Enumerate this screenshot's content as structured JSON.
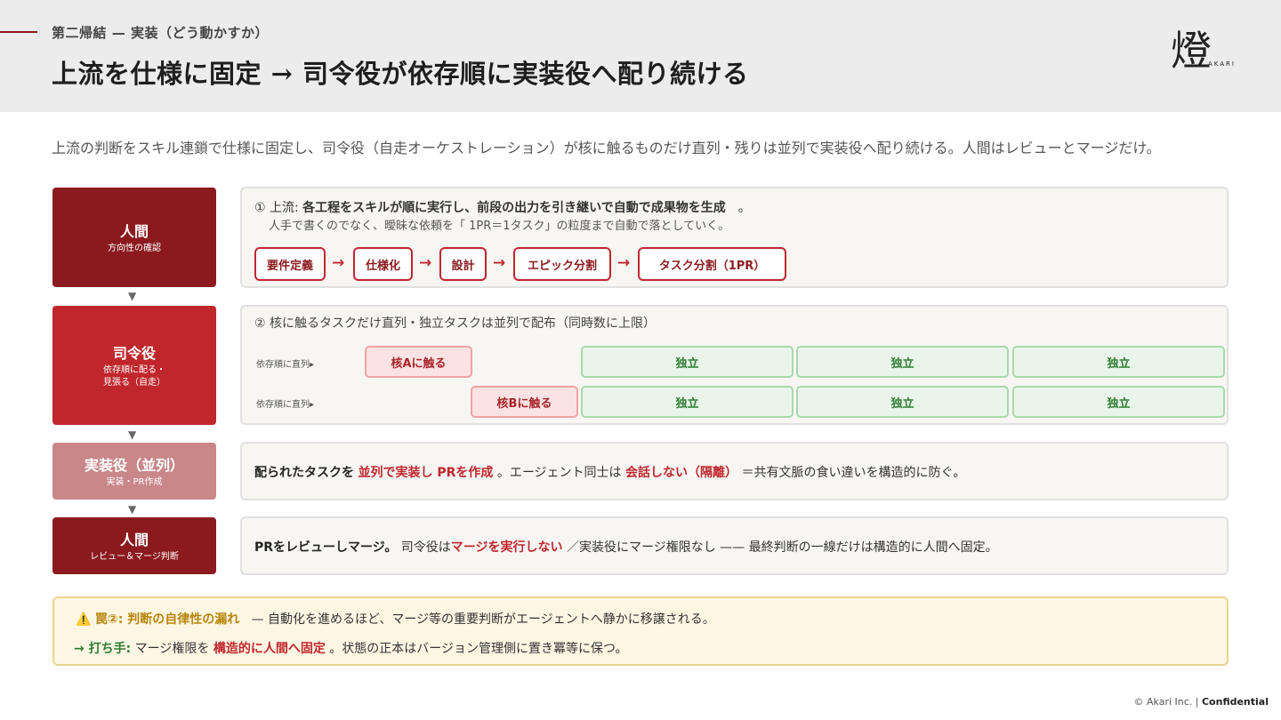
{
  "header": {
    "eyebrow": "第二帰結 — 実装（どう動かすか）",
    "title": "上流を仕様に固定 → 司令役が依存順に実装役へ配り続ける",
    "logo_glyph": "燈",
    "logo_text": "AKARI"
  },
  "subtitle": "上流の判断をスキル連鎖で仕様に固定し、司令役（自走オーケストレーション）が核に触るものだけ直列・残りは並列で実装役へ配り続ける。人間はレビューとマージだけ。",
  "roles": [
    {
      "name": "人間",
      "sub": "方向性の確認"
    },
    {
      "name": "司令役",
      "sub": "依存順に配る・\n見張る（自走）"
    },
    {
      "name": "実装役（並列）",
      "sub": "実装・PR作成"
    },
    {
      "name": "人間",
      "sub": "レビュー＆マージ判断"
    }
  ],
  "down_arrow": "▼",
  "upstream": {
    "prefix": "① 上流: ",
    "bold": "各工程をスキルが順に実行し、前段の出力を引き継いで自動で成果物を生成",
    "suffix": "　。",
    "note": "人手で書くのでなく、曖昧な依頼を「 1PR＝1タスク」の粒度まで自動で落としていく。",
    "steps": [
      "要件定義",
      "仕様化",
      "設計",
      "エピック分割",
      "タスク分割（1PR）"
    ],
    "arrow": "→"
  },
  "dispatch": {
    "title": "② 核に触るタスクだけ直列・独立タスクは並列で配布（同時数に上限）",
    "lanes": [
      {
        "label": "依存順に直列▸",
        "core": "核Aに触る",
        "indep": [
          "独立",
          "独立",
          "独立"
        ]
      },
      {
        "label": "依存順に直列▸",
        "core": "核Bに触る",
        "indep": [
          "独立",
          "独立",
          "独立"
        ]
      }
    ]
  },
  "implement": {
    "t1": "配られたタスクを",
    "t2": "並列で実装し PRを作成",
    "t3": "。エージェント同士は",
    "t4": "会話しない（隔離）",
    "t5": "＝共有文脈の食い違いを構造的に防ぐ。"
  },
  "review": {
    "t1": "PRをレビューしマージ。",
    "t2": "司令役は",
    "t3": "マージを実行しない",
    "t4": "／実装役にマージ権限なし —— 最終判断の一線だけは構造的に人間へ固定。"
  },
  "warning": {
    "icon": "⚠️",
    "head": "罠②: 判断の自律性の漏れ",
    "text1": "— 自動化を進めるほど、マージ等の重要判断がエージェントへ静かに移譲される。",
    "fix_label": "→ 打ち手:",
    "fix1": "マージ権限を",
    "fix_red": "構造的に人間へ固定",
    "fix2": "。状態の正本はバージョン管理側に置き冪等に保つ。"
  },
  "footer": {
    "copy": "© Akari Inc. | ",
    "conf": "Confidential"
  }
}
